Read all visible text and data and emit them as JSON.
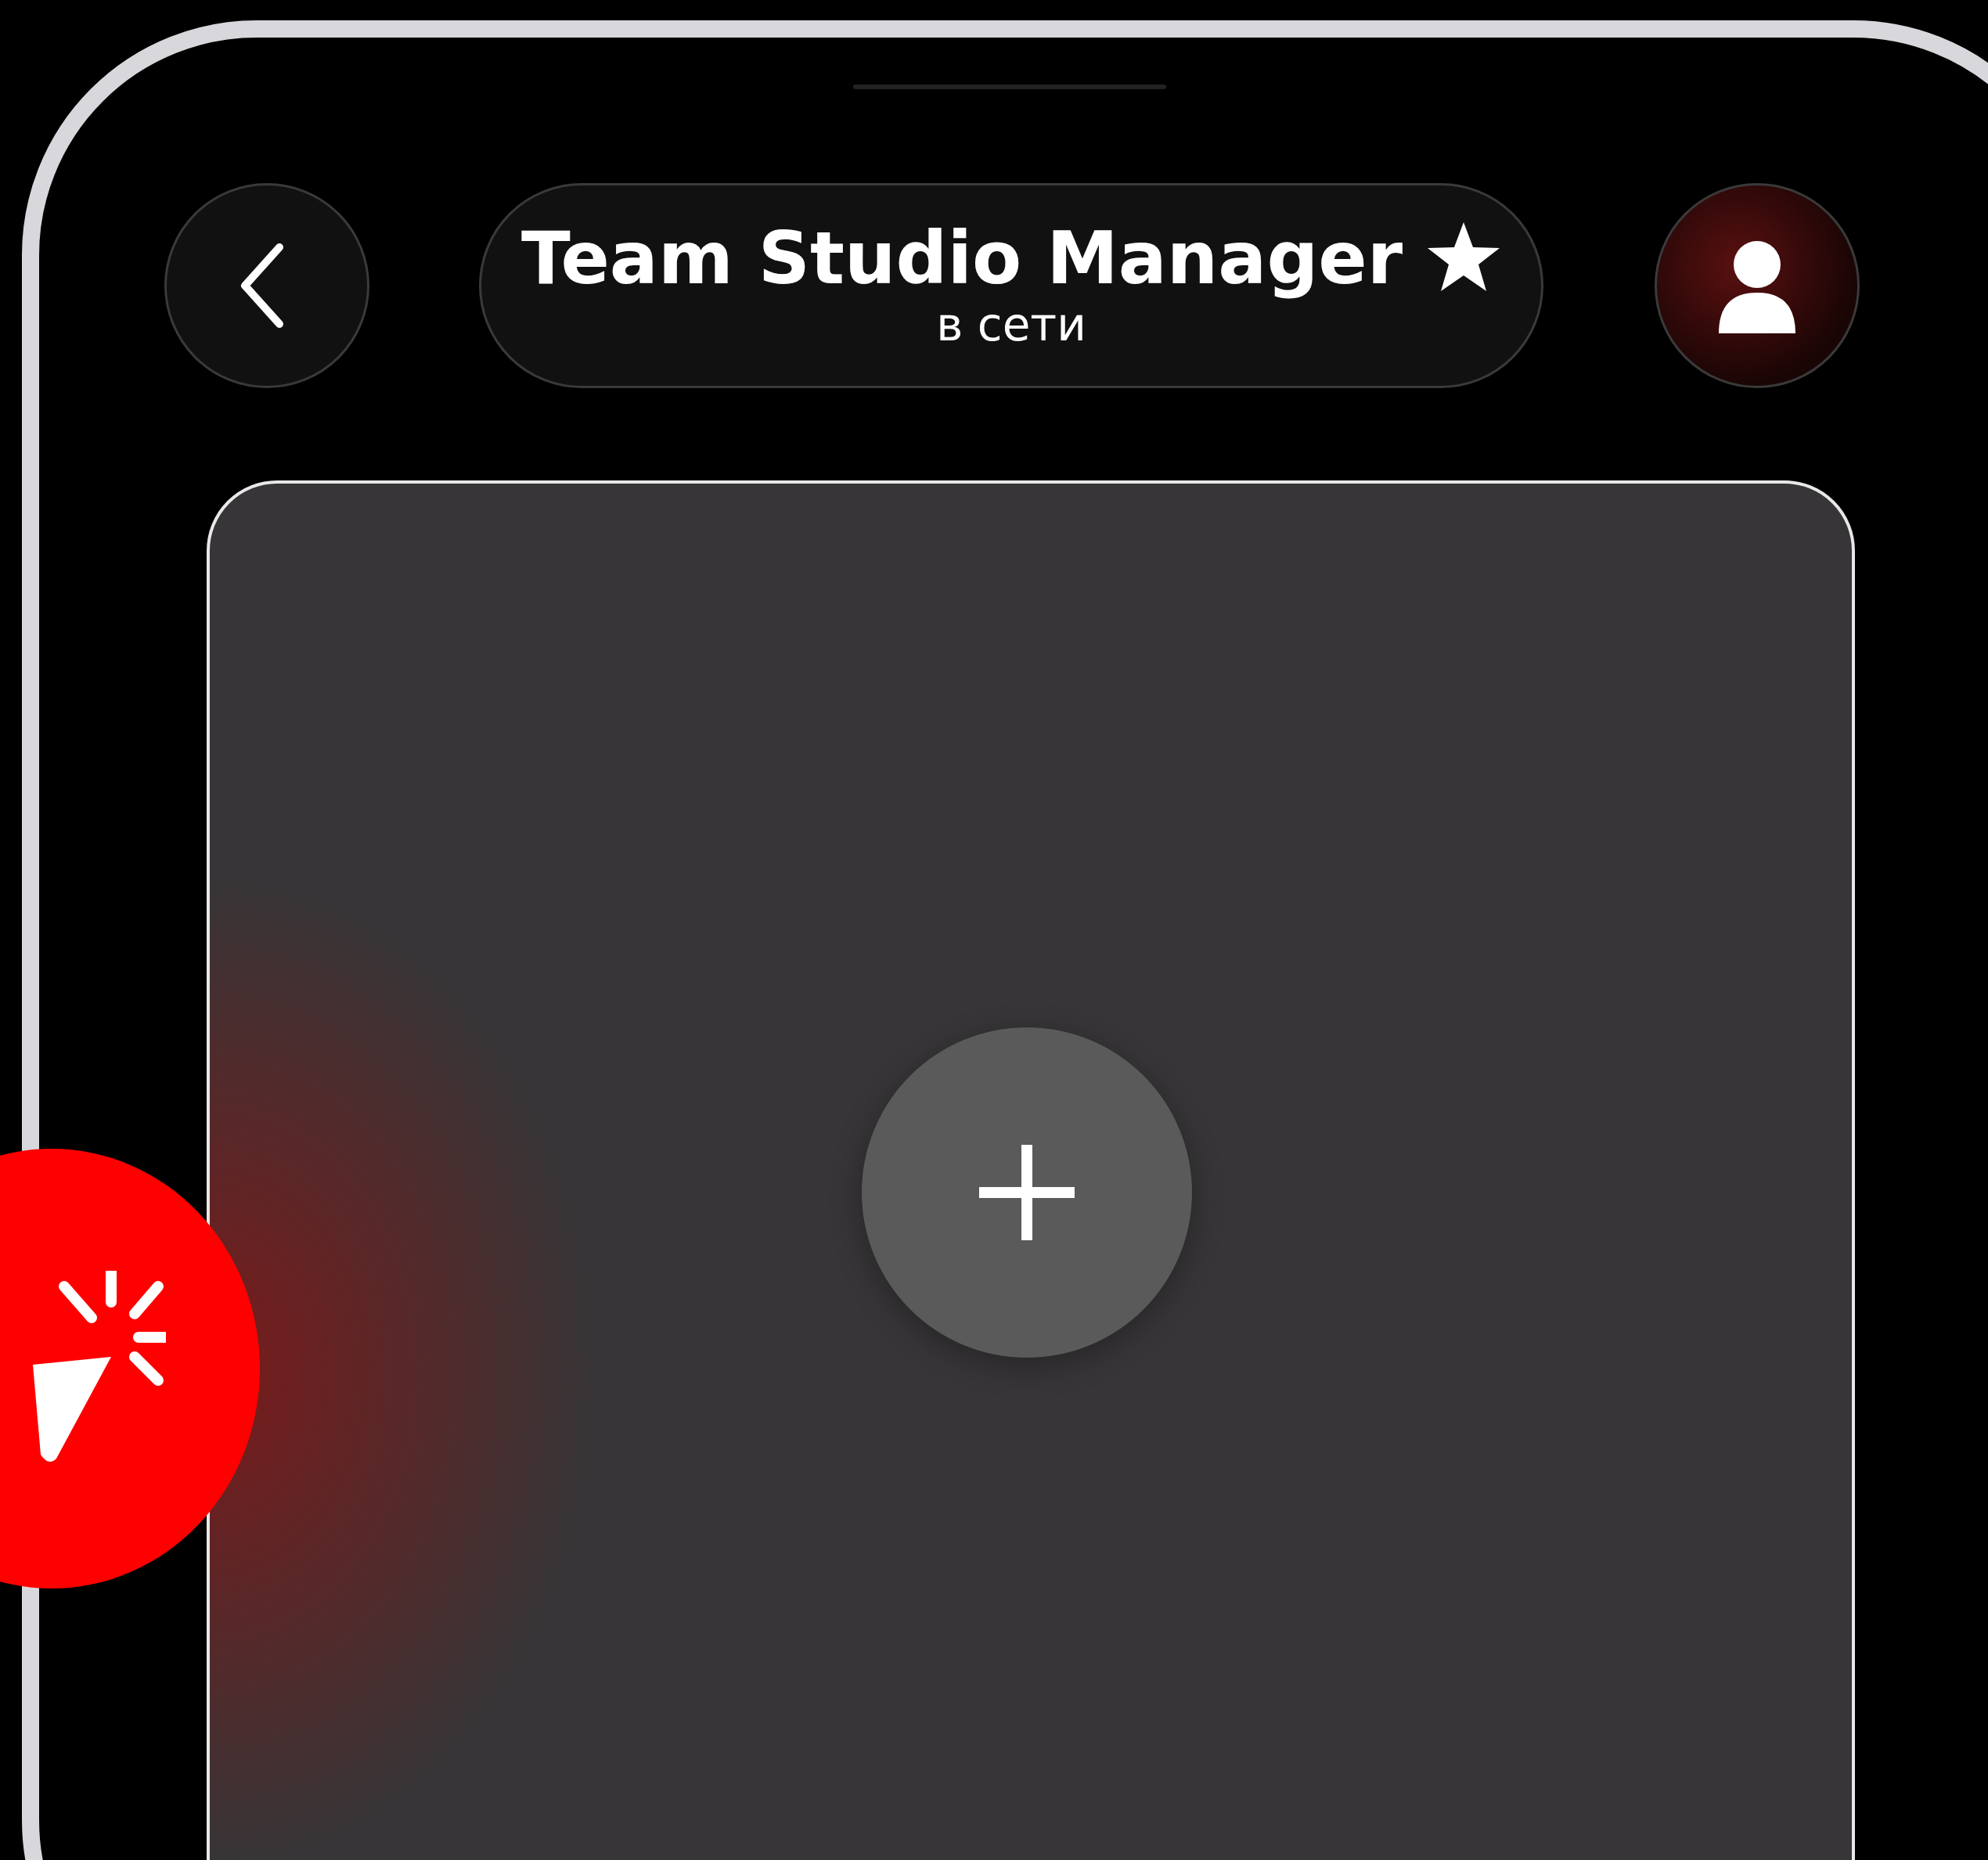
{
  "header": {
    "title": "Team Studio Manager",
    "starred": true,
    "status": "в сети"
  }
}
